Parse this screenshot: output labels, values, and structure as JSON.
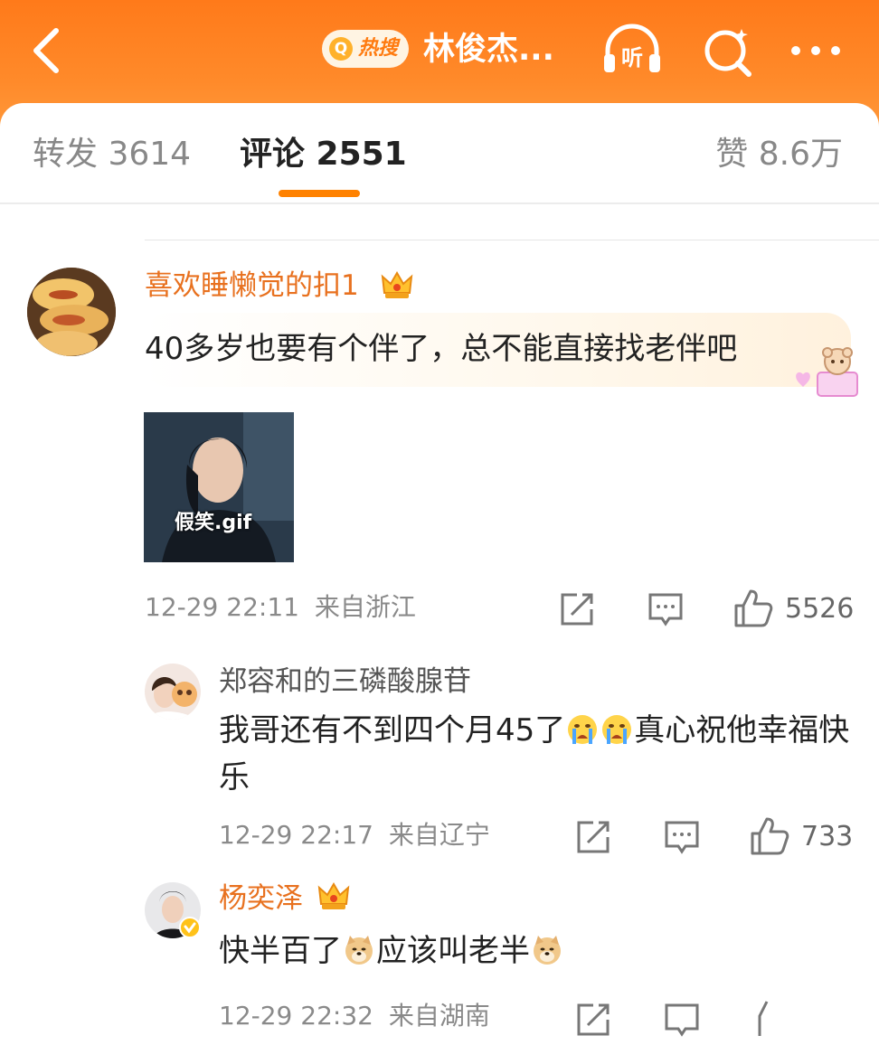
{
  "header": {
    "hot_search_label": "热搜",
    "title": "林俊杰...",
    "accent_color": "#ff8200"
  },
  "tabs": {
    "repost": "转发 3614",
    "comment": "评论 2551",
    "like": "赞 8.6万"
  },
  "comments": [
    {
      "username": "喜欢睡懒觉的扣1",
      "text": "40多岁也要有个伴了，总不能直接找老伴吧",
      "gif_label": "假笑.gif",
      "time": "12-29 22:11",
      "location": "来自浙江",
      "likes": "5526"
    }
  ],
  "replies": [
    {
      "username": "郑容和的三磷酸腺苷",
      "text_part1": "我哥还有不到四个月45了",
      "emoji": "crying-face",
      "text_part2": "真心祝他幸福快乐",
      "time": "12-29 22:17",
      "location": "来自辽宁",
      "likes": "733"
    },
    {
      "username": "杨奕泽",
      "text_part1": "快半百了",
      "emoji": "doge-face",
      "text_part2": "应该叫老半",
      "time": "12-29 22:32",
      "location": "来自湖南"
    }
  ]
}
